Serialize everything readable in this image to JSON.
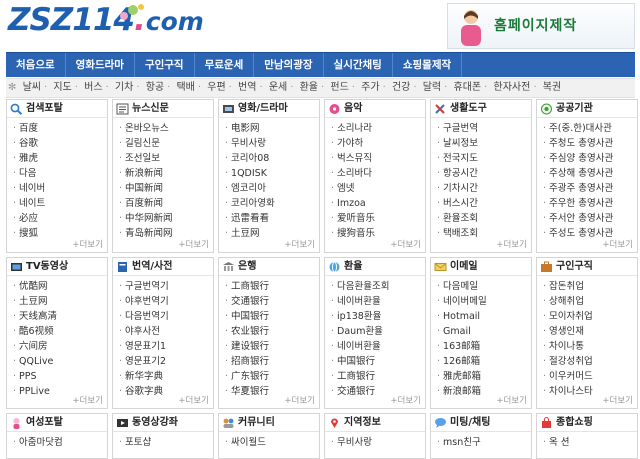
{
  "logo": {
    "main": "ZSZ114",
    "dot": ".",
    "com": "com"
  },
  "banner": {
    "text": "홈페이지제작"
  },
  "nav": [
    "처음으로",
    "영화드라마",
    "구인구직",
    "무료운세",
    "만남의광장",
    "실시간채팅",
    "쇼핑몰제작"
  ],
  "quick": [
    "날씨",
    "지도",
    "버스",
    "기차",
    "항공",
    "택배",
    "우편",
    "번역",
    "운세",
    "환율",
    "펀드",
    "주가",
    "건강",
    "달력",
    "휴대폰",
    "한자사전",
    "복권"
  ],
  "more_label": "+더보기",
  "boxes": [
    {
      "title": "검색포탈",
      "icon": "magnifier-icon",
      "items": [
        "百度",
        "谷歌",
        "雅虎",
        "다음",
        "네이버",
        "네이트",
        "必应",
        "搜狐"
      ]
    },
    {
      "title": "뉴스신문",
      "icon": "newspaper-icon",
      "items": [
        "온바오뉴스",
        "길림신문",
        "조선일보",
        "新浪新闻",
        "中国新闻",
        "百度新闻",
        "中华网新闻",
        "青岛新闻网"
      ]
    },
    {
      "title": "영화/드라마",
      "icon": "film-icon",
      "items": [
        "电影网",
        "무비사랑",
        "코리아08",
        "1QDISK",
        "엠코리아",
        "코리아영화",
        "迅雷看看",
        "土豆网"
      ]
    },
    {
      "title": "음악",
      "icon": "music-icon",
      "items": [
        "소리나라",
        "가야하",
        "벅스뮤직",
        "소리바다",
        "엠넷",
        "Imzoa",
        "爱听音乐",
        "搜狗音乐"
      ]
    },
    {
      "title": "생활도구",
      "icon": "tools-icon",
      "items": [
        "구글번역",
        "날씨정보",
        "전국지도",
        "항공시간",
        "기차시간",
        "버스시간",
        "환율조회",
        "택배조회"
      ]
    },
    {
      "title": "공공기관",
      "icon": "government-icon",
      "items": [
        "주(중.한)대사관",
        "주청도 총영사관",
        "주심양 총영사관",
        "주상해 총영사관",
        "주광주 총영사관",
        "주우한 총영사관",
        "주서안 총영사관",
        "주성도 총영사관"
      ]
    },
    {
      "title": "TV동영상",
      "icon": "tv-icon",
      "items": [
        "优酷网",
        "土豆网",
        "天线高清",
        "酷6视频",
        "六间房",
        "QQLive",
        "PPS",
        "PPLive"
      ]
    },
    {
      "title": "번역/사전",
      "icon": "dictionary-icon",
      "items": [
        "구글번역기",
        "야후번역기",
        "다음번역기",
        "야후사전",
        "영문표기1",
        "영문표기2",
        "新华字典",
        "谷歌字典"
      ]
    },
    {
      "title": "은행",
      "icon": "bank-icon",
      "items": [
        "工商银行",
        "交通银行",
        "中国银行",
        "农业银行",
        "建设银行",
        "招商银行",
        "广东银行",
        "华夏银行"
      ]
    },
    {
      "title": "환율",
      "icon": "globe-icon",
      "items": [
        "다음환율조회",
        "네이버환율",
        "ip138환율",
        "Daum환율",
        "네이버환율",
        "中国银行",
        "工商银行",
        "交通银行"
      ]
    },
    {
      "title": "이메일",
      "icon": "mail-icon",
      "items": [
        "다음메일",
        "네이버메일",
        "Hotmail",
        "Gmail",
        "163邮箱",
        "126邮箱",
        "雅虎邮箱",
        "新浪邮箱"
      ]
    },
    {
      "title": "구인구직",
      "icon": "job-icon",
      "items": [
        "잡돈취업",
        "상해취업",
        "모이자취업",
        "영생인재",
        "차이나통",
        "절강성취업",
        "이우커머드",
        "차이나스타"
      ]
    },
    {
      "title": "여성포탈",
      "icon": "woman-icon",
      "items": [
        "아줌마닷컴"
      ]
    },
    {
      "title": "동영상강좌",
      "icon": "video-lecture-icon",
      "items": [
        "포토샵"
      ]
    },
    {
      "title": "커뮤니티",
      "icon": "community-icon",
      "items": [
        "싸이월드"
      ]
    },
    {
      "title": "지역정보",
      "icon": "map-pin-icon",
      "items": [
        "무비사랑"
      ]
    },
    {
      "title": "미팅/채팅",
      "icon": "chat-icon",
      "items": [
        "msn친구"
      ]
    },
    {
      "title": "종합쇼핑",
      "icon": "shopping-icon",
      "items": [
        "옥 션"
      ]
    }
  ],
  "colors": {
    "nav_bg": "#2a64b3",
    "accent_green": "#1b7a3a",
    "logo_blue": "#1f5fb0",
    "logo_pink": "#e24a8a"
  }
}
